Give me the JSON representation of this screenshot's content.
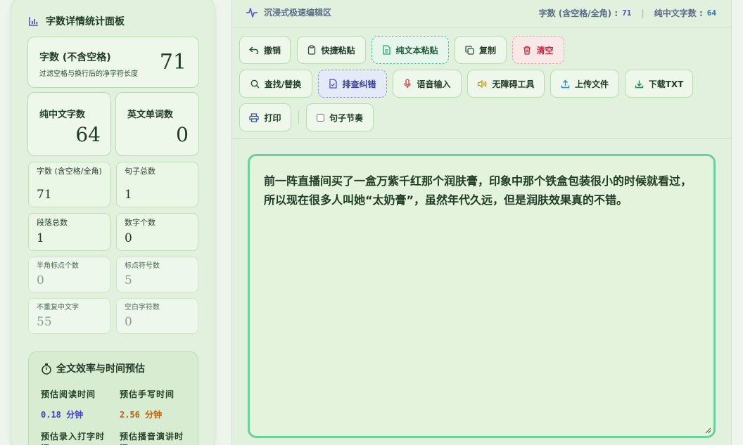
{
  "stats_panel": {
    "title": "字数详情统计面板",
    "main": {
      "label": "字数 (不含空格)",
      "sublabel": "过滤空格与换行后的净字符长度",
      "value": "71"
    },
    "chinese": {
      "label": "纯中文字数",
      "value": "64"
    },
    "english": {
      "label": "英文单词数",
      "value": "0"
    },
    "small": [
      {
        "label": "字数 (含空格/全角)",
        "value": "71"
      },
      {
        "label": "句子总数",
        "value": "1"
      },
      {
        "label": "段落总数",
        "value": "1"
      },
      {
        "label": "数字个数",
        "value": "0"
      },
      {
        "label": "半角标点个数",
        "value": "0"
      },
      {
        "label": "标点符号数",
        "value": "5"
      },
      {
        "label": "不重复中文字",
        "value": "55"
      },
      {
        "label": "空白字符数",
        "value": "0"
      }
    ]
  },
  "efficiency": {
    "title": "全文效率与时间预估",
    "items": [
      {
        "label": "预估阅读时间",
        "value": "0.18 分钟",
        "color": "#3f3fd0"
      },
      {
        "label": "预估手写时间",
        "value": "2.56 分钟",
        "color": "#c0600a"
      },
      {
        "label": "预估录入打字时间",
        "value": "",
        "color": "#1f3a26"
      },
      {
        "label": "预估播音演讲时间",
        "value": "",
        "color": "#1f3a26"
      }
    ]
  },
  "header": {
    "title": "沉浸式极速编辑区",
    "stat1_label": "字数 (含空格/全角) :",
    "stat1_value": "71",
    "stat2_label": "纯中文字数 :",
    "stat2_value": "64"
  },
  "toolbar": {
    "undo": "撤销",
    "quick_paste": "快捷粘贴",
    "plain_paste": "纯文本粘贴",
    "copy": "复制",
    "clear": "清空",
    "find_replace": "查找/替换",
    "proofread": "排查纠错",
    "voice_input": "语音输入",
    "accessibility": "无障碍工具",
    "upload": "上传文件",
    "download": "下载TXT",
    "print": "打印",
    "rhythm": "句子节奏"
  },
  "editor": {
    "text": "前一阵直播间买了一盒万紫千红那个润肤膏，印象中那个铁盒包装很小的时候就看过，所以现在很多人叫她“太奶膏”，虽然年代久远，但是润肤效果真的不错。"
  },
  "colors": {
    "accent": "#6bd19a",
    "panel": "#e2f1de",
    "danger": "#c0283c"
  }
}
